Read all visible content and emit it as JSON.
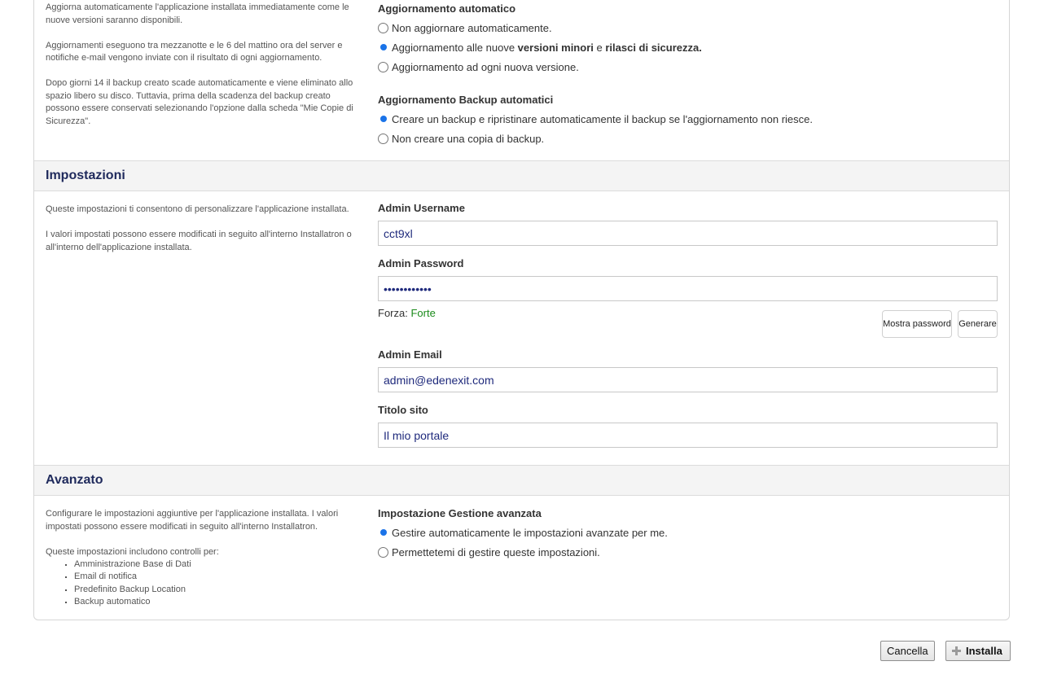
{
  "auto_update": {
    "description": [
      "Aggiorna automaticamente l'applicazione installata immediatamente come le nuove versioni saranno disponibili.",
      "Aggiornamenti eseguono tra mezzanotte e le 6 del mattino ora del server e notifiche e-mail vengono inviate con il risultato di ogni aggiornamento.",
      "Dopo giorni 14 il backup creato scade automaticamente e viene eliminato allo spazio libero su disco. Tuttavia, prima della scadenza del backup creato possono essere conservati selezionando l'opzione dalla scheda \"Mie Copie di Sicurezza\"."
    ],
    "title": "Aggiornamento automatico",
    "options": [
      {
        "label": "Non aggiornare automaticamente.",
        "checked": false
      },
      {
        "pre": "Aggiornamento alle nuove ",
        "bold1": "versioni minori",
        "mid": " e ",
        "bold2": "rilasci di sicurezza.",
        "checked": true
      },
      {
        "label": "Aggiornamento ad ogni nuova versione.",
        "checked": false
      }
    ],
    "backup_title": "Aggiornamento Backup automatici",
    "backup_options": [
      {
        "label": "Creare un backup e ripristinare automaticamente il backup se l'aggiornamento non riesce.",
        "checked": true
      },
      {
        "label": "Non creare una copia di backup.",
        "checked": false
      }
    ]
  },
  "settings": {
    "header": "Impostazioni",
    "description": [
      "Queste impostazioni ti consentono di personalizzare l'applicazione installata.",
      "I valori impostati possono essere modificati in seguito all'interno Installatron o all'interno dell'applicazione installata."
    ],
    "admin_username_label": "Admin Username",
    "admin_username_value": "cct9xl",
    "admin_password_label": "Admin Password",
    "admin_password_value": "xK7pQ2mL9vRt",
    "strength_label": "Forza:",
    "strength_value": "Forte",
    "show_password_label": "Mostra password",
    "generate_label": "Generare",
    "admin_email_label": "Admin Email",
    "admin_email_value": "admin@edenexit.com",
    "site_title_label": "Titolo sito",
    "site_title_value": "Il mio portale"
  },
  "advanced": {
    "header": "Avanzato",
    "description": "Configurare le impostazioni aggiuntive per l'applicazione installata. I valori impostati possono essere modificati in seguito all'interno Installatron.",
    "controls_intro": "Queste impostazioni includono controlli per:",
    "controls": [
      "Amministrazione Base di Dati",
      "Email di notifica",
      "Predefinito Backup Location",
      "Backup automatico"
    ],
    "title": "Impostazione Gestione avanzata",
    "options": [
      {
        "label": "Gestire automaticamente le impostazioni avanzate per me.",
        "checked": true
      },
      {
        "label": "Permettetemi di gestire queste impostazioni.",
        "checked": false
      }
    ]
  },
  "actions": {
    "cancel_label": "Cancella",
    "install_label": "Installa"
  },
  "colors": {
    "accent": "#1a73e8",
    "header_text": "#1f2a5c",
    "strength_good": "#1a8a1a",
    "input_text": "#1f2a7c"
  }
}
